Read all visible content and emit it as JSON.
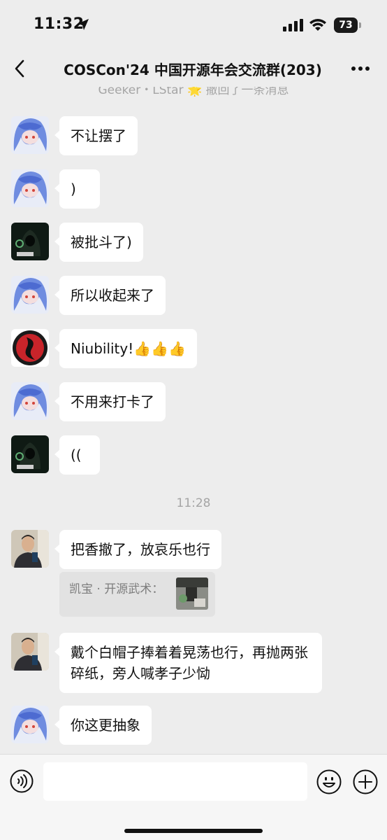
{
  "status_bar": {
    "time": "11:32",
    "battery": "73"
  },
  "header": {
    "title": "COSCon'24 中国开源年会交流群(203)"
  },
  "recall_notice": "Geeker・LStar 🌟 撤回了一条消息",
  "messages": [
    {
      "text": "不让摆了",
      "avatar": "anime-blue-hair-avatar"
    },
    {
      "text": ")",
      "avatar": "anime-blue-hair-avatar"
    },
    {
      "text": "被批斗了)",
      "avatar": "hooded-hacker-avatar"
    },
    {
      "text": "所以收起来了",
      "avatar": "anime-blue-hair-avatar"
    },
    {
      "text": "Niubility!👍👍👍",
      "avatar": "red-circle-logo-avatar"
    },
    {
      "text": "不用来打卡了",
      "avatar": "anime-blue-hair-avatar"
    },
    {
      "text": "((",
      "avatar": "hooded-hacker-avatar"
    },
    {
      "text": "把香撤了，放哀乐也行",
      "avatar": "man-photo-avatar"
    },
    {
      "text": "戴个白帽子捧着着晃荡也行，再抛两张碎纸，旁人喊孝子少恸",
      "avatar": "man-photo-avatar"
    },
    {
      "text": "你这更抽象",
      "avatar": "anime-blue-hair-avatar"
    }
  ],
  "time_divider": "11:28",
  "quote": {
    "text": "凯宝 · 开源武术："
  },
  "input": {
    "placeholder": ""
  },
  "colors": {
    "background": "#ededed",
    "bubble": "#ffffff",
    "meta_text": "#a5a5a5"
  }
}
